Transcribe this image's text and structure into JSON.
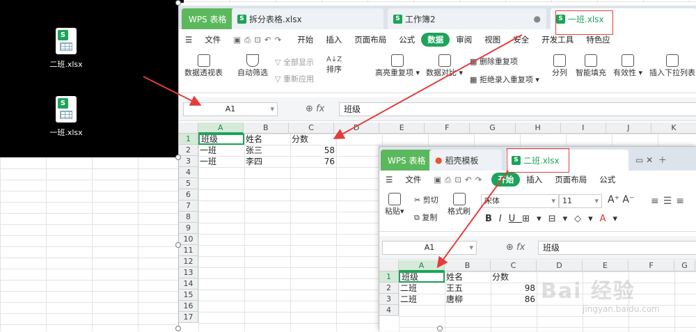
{
  "desktop": {
    "icons": [
      {
        "label": "二班.xlsx",
        "badge": "S"
      },
      {
        "label": "一班.xlsx",
        "badge": "S"
      }
    ]
  },
  "win1": {
    "tabs": {
      "app": "WPS 表格",
      "t1": "拆分表格.xlsx",
      "t2": "工作簿2",
      "t3": "一班.xlsx"
    },
    "menu": {
      "file": "文件",
      "items": [
        "开始",
        "插入",
        "页面布局",
        "公式",
        "数据",
        "审阅",
        "视图",
        "安全",
        "开发工具",
        "特色应"
      ],
      "active": "数据"
    },
    "ribbon": {
      "pivot": "数据透视表",
      "autofilter": "自动筛选",
      "showall": "全部显示",
      "reapply": "重新应用",
      "sort": "排序",
      "highlight_dup": "高亮重复项",
      "compare": "数据对比",
      "del_dup": "删除重复项",
      "reject_dup": "拒绝录入重复项",
      "split": "分列",
      "smartfill": "智能填充",
      "validity": "有效性",
      "dropdown": "插入下拉列表"
    },
    "namebox": "A1",
    "formula": "班级",
    "cols": [
      "A",
      "B",
      "C",
      "D",
      "E",
      "F",
      "G",
      "H",
      "I",
      "J",
      "K"
    ],
    "rows": [
      "1",
      "2",
      "3",
      "4",
      "5",
      "6",
      "7",
      "8",
      "9",
      "10",
      "11",
      "12",
      "13",
      "14",
      "15",
      "16",
      "17"
    ],
    "cells": {
      "r1": [
        "班级",
        "姓名",
        "分数"
      ],
      "r2": [
        "一班",
        "张三",
        "58"
      ],
      "r3": [
        "一班",
        "李四",
        "76"
      ]
    }
  },
  "win2": {
    "tabs": {
      "app": "WPS 表格",
      "t1": "稻壳模板",
      "t2": "二班.xlsx"
    },
    "menu": {
      "file": "文件",
      "items": [
        "开始",
        "插入",
        "页面布局",
        "公式"
      ],
      "active": "开始"
    },
    "ribbon": {
      "paste": "粘贴",
      "cut": "剪切",
      "copy": "复制",
      "format_painter": "格式刷",
      "font": "宋体",
      "size": "11"
    },
    "namebox": "A1",
    "formula": "班级",
    "cols": [
      "A",
      "B",
      "C",
      "D",
      "E",
      "F",
      "G"
    ],
    "rows": [
      "1",
      "2",
      "3",
      "4"
    ],
    "cells": {
      "r1": [
        "班级",
        "姓名",
        "分数"
      ],
      "r2": [
        "二班",
        "王五",
        "98"
      ],
      "r3": [
        "二班",
        "唐柳",
        "86"
      ]
    }
  },
  "watermark": {
    "main": "Bai 经验",
    "url": "jingyan.baidu.com"
  },
  "colors": {
    "accent": "#1ea35a",
    "arrow": "#e63c3c"
  }
}
